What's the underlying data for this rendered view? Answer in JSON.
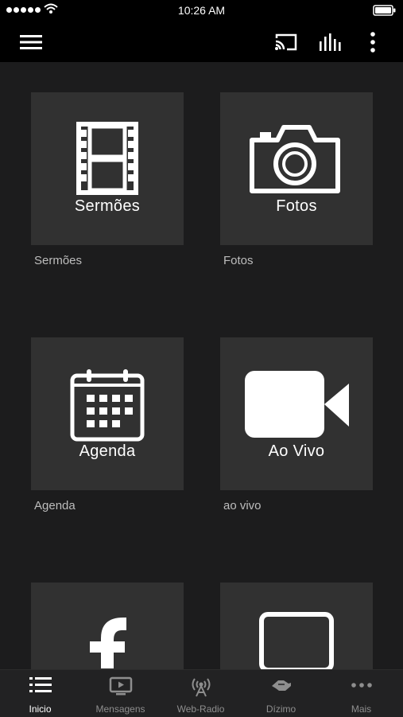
{
  "status_bar": {
    "time": "10:26 AM"
  },
  "tiles": [
    {
      "caption": "Sermões",
      "label": "Sermões",
      "icon": "film-icon"
    },
    {
      "caption": "Fotos",
      "label": "Fotos",
      "icon": "camera-icon"
    },
    {
      "caption": "Agenda",
      "label": "Agenda",
      "icon": "calendar-icon"
    },
    {
      "caption": "Ao Vivo",
      "label": "ao vivo",
      "icon": "video-camera-icon"
    },
    {
      "caption": "",
      "label": "",
      "icon": "facebook-icon"
    },
    {
      "caption": "",
      "label": "",
      "icon": "tablet-icon"
    }
  ],
  "tabs": [
    {
      "label": "Inicio",
      "icon": "list-icon",
      "active": true
    },
    {
      "label": "Mensagens",
      "icon": "tv-play-icon",
      "active": false
    },
    {
      "label": "Web-Radio",
      "icon": "antenna-icon",
      "active": false
    },
    {
      "label": "Dízimo",
      "icon": "handshake-icon",
      "active": false
    },
    {
      "label": "Mais",
      "icon": "more-dots-icon",
      "active": false
    }
  ],
  "colors": {
    "background": "#1c1c1d",
    "tile": "#313131",
    "bar": "#000000",
    "tab_bar": "#222223"
  }
}
